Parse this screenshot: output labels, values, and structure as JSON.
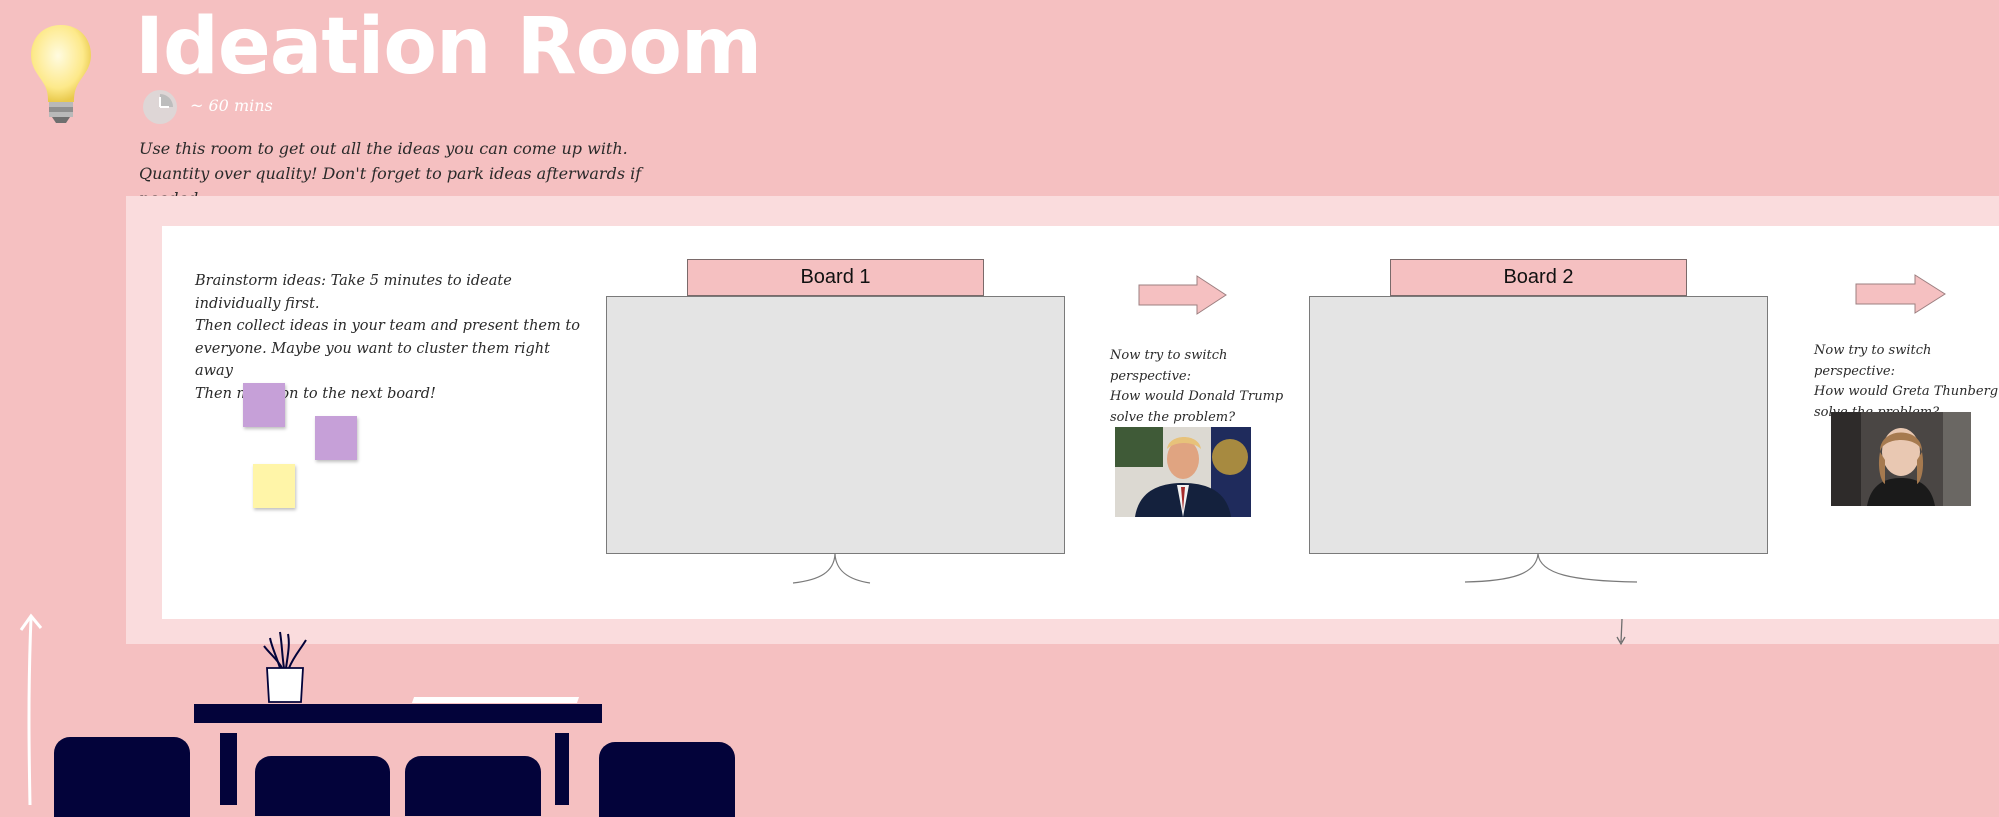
{
  "header": {
    "title": "Ideation Room",
    "duration": "~ 60 mins",
    "description": "Use this room to get out all the ideas you can come up with. Quantity over quality! Don't forget to park ideas afterwards if needed."
  },
  "instructions": {
    "lines": [
      "Brainstorm ideas: Take 5 minutes to ideate individually first.",
      "Then collect ideas in your team and present them to",
      "everyone. Maybe you want to cluster them right away",
      "Then move on to the next board!"
    ]
  },
  "boards": [
    {
      "label": "Board 1"
    },
    {
      "label": "Board 2"
    }
  ],
  "perspectives": [
    {
      "lines": [
        "Now try to switch perspective:",
        "How would Donald Trump",
        "solve the problem?"
      ],
      "image_icon": "portrait-photo"
    },
    {
      "lines": [
        "Now try to switch perspective:",
        "How would Greta Thunberg",
        "solve the problem?"
      ],
      "image_icon": "portrait-photo"
    }
  ],
  "colors": {
    "background": "#f5c0c1",
    "frame": "#fadcdd",
    "board": "#e4e4e4",
    "sticky_purple": "#c6a0d8",
    "sticky_yellow": "#fff5a8",
    "furniture": "#03033a"
  },
  "icons": [
    "lightbulb-icon",
    "clock-icon",
    "arrow-right-icon",
    "arrow-up-icon"
  ]
}
